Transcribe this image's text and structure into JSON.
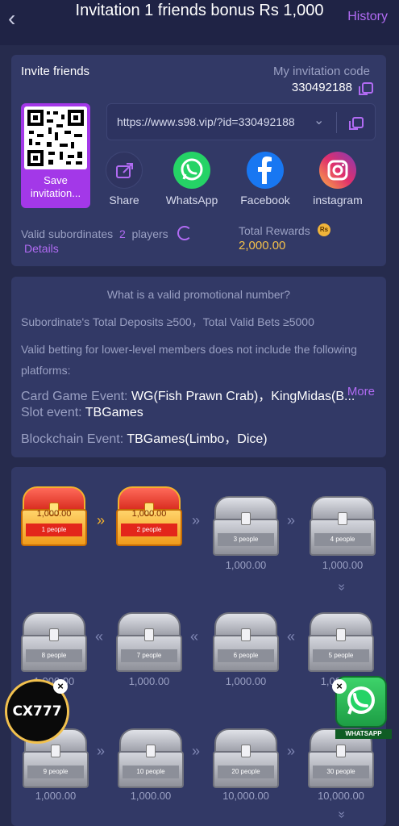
{
  "header": {
    "title": "Invitation 1 friends bonus Rs 1,000",
    "history_label": "History"
  },
  "invite": {
    "title": "Invite friends",
    "code_label": "My invitation code",
    "code_value": "330492188",
    "qr_save_label": "Save invitation...",
    "url": "https://www.s98.vip/?id=330492188",
    "share_items": [
      {
        "label": "Share",
        "icon": "share-icon",
        "color": "#2f3460"
      },
      {
        "label": "WhatsApp",
        "icon": "whatsapp-icon",
        "color": "#25d366"
      },
      {
        "label": "Facebook",
        "icon": "facebook-icon",
        "color": "#1877f2"
      },
      {
        "label": "instagram",
        "icon": "instagram-icon",
        "color": "#d62f84"
      }
    ],
    "valid_subordinates_label": "Valid subordinates",
    "valid_subordinates_count": "2",
    "valid_subordinates_unit": "players",
    "details_label": "Details",
    "total_rewards_label": "Total Rewards",
    "total_rewards_currency": "Rs",
    "total_rewards_value": "2,000.00"
  },
  "promo": {
    "question": "What is a valid promotional number?",
    "rule_line": "Subordinate's Total Deposits ≥500，Total Valid Bets ≥5000",
    "exclusion_intro": "Valid betting for lower-level members does not include the following",
    "exclusion_intro2": "platforms:",
    "card_label": "Card Game Event:",
    "card_value": "WG(Fish Prawn Crab)，KingMidas(B...",
    "more_label": "More",
    "slot_label": "Slot event:",
    "slot_value": "TBGames",
    "blockchain_label": "Blockchain Event:",
    "blockchain_value": "TBGames(Limbo，Dice)"
  },
  "chests": [
    {
      "people": "1 people",
      "amount": "1,000.00",
      "opened": true
    },
    {
      "people": "2 people",
      "amount": "1,000.00",
      "opened": true
    },
    {
      "people": "3 people",
      "value": "1,000.00",
      "opened": false
    },
    {
      "people": "4 people",
      "value": "1,000.00",
      "opened": false
    },
    {
      "people": "5 people",
      "value": "1,000.00",
      "opened": false
    },
    {
      "people": "6 people",
      "value": "1,000.00",
      "opened": false
    },
    {
      "people": "7 people",
      "value": "1,000.00",
      "opened": false
    },
    {
      "people": "8 people",
      "value": "1,000.00",
      "opened": false
    },
    {
      "people": "9 people",
      "value": "1,000.00",
      "opened": false
    },
    {
      "people": "10 people",
      "value": "1,000.00",
      "opened": false
    },
    {
      "people": "20 people",
      "value": "10,000.00",
      "opened": false
    },
    {
      "people": "30 people",
      "value": "10,000.00",
      "opened": false
    }
  ],
  "floating": {
    "cx_label": "CX777",
    "whatsapp_label": "WHATSAPP",
    "close_glyph": "×"
  }
}
